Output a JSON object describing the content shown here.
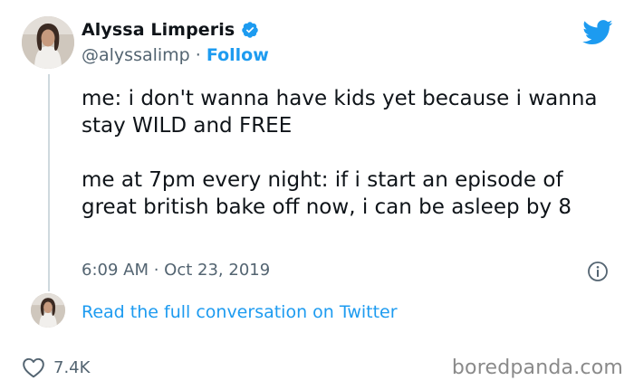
{
  "tweet": {
    "author_name": "Alyssa Limperis",
    "verified": true,
    "handle": "@alyssalimp",
    "separator": " · ",
    "follow_label": "Follow",
    "text_paragraph_1": "me: i don't wanna have kids yet because i wanna stay WILD and FREE",
    "text_paragraph_2": "me at 7pm every night: if i start an episode of great british bake off now, i can be asleep by 8",
    "time": "6:09 AM",
    "date_separator": " · ",
    "date": "Oct 23, 2019",
    "read_conversation_label": "Read the full conversation on Twitter",
    "like_count": "7.4K"
  },
  "icons": {
    "platform_logo": "twitter-bird-icon",
    "verified": "verified-badge-icon",
    "info": "info-icon",
    "like": "heart-icon"
  },
  "colors": {
    "accent": "#1d9bf0",
    "text": "#0f1419",
    "secondary_text": "#536471",
    "thread_line": "#cfd9de",
    "watermark": "#8a8a8a"
  },
  "watermark": "boredpanda.com"
}
